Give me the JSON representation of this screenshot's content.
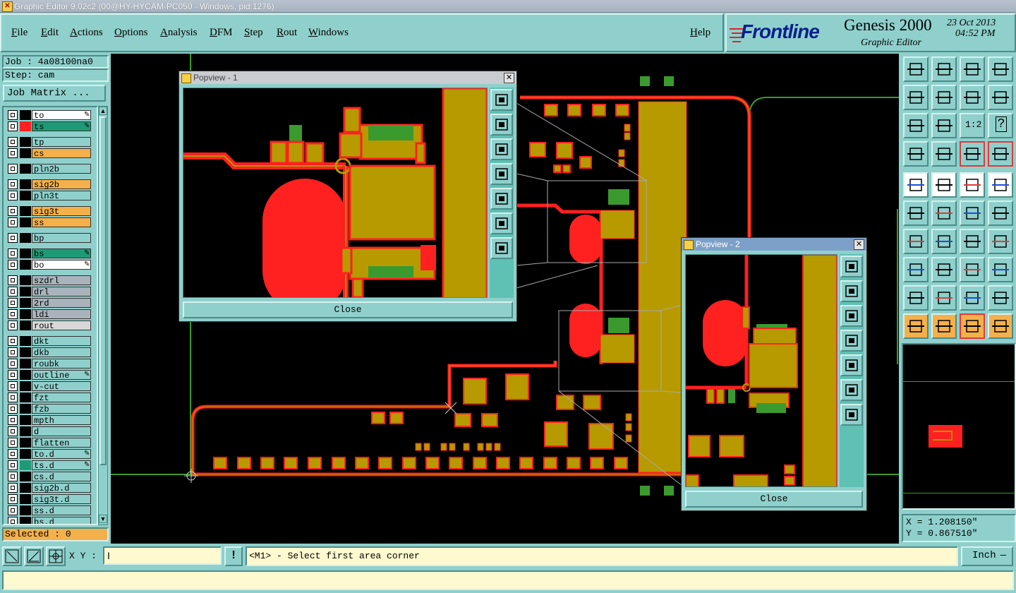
{
  "window": {
    "title": "Graphic Editor 9.02c2 (00@HY-HYCAM-PC050 - Windows, pid:1276)"
  },
  "menu": {
    "items": [
      "File",
      "Edit",
      "Actions",
      "Options",
      "Analysis",
      "DFM",
      "Step",
      "Rout",
      "Windows"
    ],
    "help": "Help"
  },
  "brand": {
    "logo": "Frontline",
    "product": "Genesis 2000",
    "subtitle": "Graphic Editor",
    "date": "23 Oct 2013",
    "time": "04:52 PM"
  },
  "job": {
    "job_label": "Job : 4a08100na0",
    "step_label": "Step: cam",
    "matrix_button": "Job Matrix ..."
  },
  "layers": [
    {
      "name": "to",
      "color": "#ffffff",
      "swatch": "#000000",
      "icon": true
    },
    {
      "name": "ts",
      "color": "#1f9a76",
      "swatch": "#ff2020",
      "icon": true
    },
    {
      "name": "tp",
      "color": "#8fd0cc",
      "swatch": "#000000"
    },
    {
      "name": "cs",
      "color": "#f4b04b",
      "swatch": "#000000"
    },
    {
      "name": "pln2b",
      "color": "#8fd0cc",
      "swatch": "#000000"
    },
    {
      "name": "sig2b",
      "color": "#f4b04b",
      "swatch": "#000000"
    },
    {
      "name": "pln3t",
      "color": "#8fd0cc",
      "swatch": "#000000"
    },
    {
      "name": "sig3t",
      "color": "#f4b04b",
      "swatch": "#000000"
    },
    {
      "name": "ss",
      "color": "#f4b04b",
      "swatch": "#000000"
    },
    {
      "name": "bp",
      "color": "#8fd0cc",
      "swatch": "#000000"
    },
    {
      "name": "bs",
      "color": "#1f9a76",
      "swatch": "#000000",
      "icon": true
    },
    {
      "name": "bo",
      "color": "#ffffff",
      "swatch": "#000000",
      "icon": true
    },
    {
      "name": "szdrl",
      "color": "#a9b3bc",
      "swatch": "#000000"
    },
    {
      "name": "drl",
      "color": "#a9b3bc",
      "swatch": "#000000"
    },
    {
      "name": "2rd",
      "color": "#a9b3bc",
      "swatch": "#000000"
    },
    {
      "name": "ldi",
      "color": "#a9b3bc",
      "swatch": "#000000"
    },
    {
      "name": "rout",
      "color": "#d8d8d8",
      "swatch": "#000000"
    },
    {
      "name": "dkt",
      "color": "#8fd0cc",
      "swatch": "#000000"
    },
    {
      "name": "dkb",
      "color": "#8fd0cc",
      "swatch": "#000000"
    },
    {
      "name": "roubk",
      "color": "#8fd0cc",
      "swatch": "#000000"
    },
    {
      "name": "outline",
      "color": "#8fd0cc",
      "swatch": "#000000",
      "icon": true
    },
    {
      "name": "v-cut",
      "color": "#8fd0cc",
      "swatch": "#000000"
    },
    {
      "name": "fzt",
      "color": "#8fd0cc",
      "swatch": "#000000"
    },
    {
      "name": "fzb",
      "color": "#8fd0cc",
      "swatch": "#000000"
    },
    {
      "name": "mpth",
      "color": "#8fd0cc",
      "swatch": "#000000"
    },
    {
      "name": "d",
      "color": "#8fd0cc",
      "swatch": "#000000"
    },
    {
      "name": "flatten",
      "color": "#8fd0cc",
      "swatch": "#000000"
    },
    {
      "name": "to.d",
      "color": "#8fd0cc",
      "swatch": "#000000",
      "icon": true
    },
    {
      "name": "ts.d",
      "color": "#8fd0cc",
      "swatch": "#1f9a76",
      "icon": true
    },
    {
      "name": "cs.d",
      "color": "#8fd0cc",
      "swatch": "#000000"
    },
    {
      "name": "sig2b.d",
      "color": "#8fd0cc",
      "swatch": "#000000"
    },
    {
      "name": "sig3t.d",
      "color": "#8fd0cc",
      "swatch": "#000000"
    },
    {
      "name": "ss.d",
      "color": "#8fd0cc",
      "swatch": "#000000"
    },
    {
      "name": "bs.d",
      "color": "#8fd0cc",
      "swatch": "#000000"
    }
  ],
  "selected": "Selected : 0",
  "popview1": {
    "title": "Popview - 1",
    "close": "Close"
  },
  "popview2": {
    "title": "Popview - 2",
    "close": "Close"
  },
  "coords": {
    "x": "X = 1.208150\"",
    "y": "Y = 0.867510\""
  },
  "statusbar": {
    "xy_label": "X Y :",
    "xy_value": "",
    "message": "<M1> - Select first area corner",
    "units": "Inch",
    "units_arrow": "—"
  },
  "toolbar_icons": [
    "zoom-home-icon",
    "zoom-in-icon",
    "home-icon",
    "layout-icon",
    "pan-left-icon",
    "pan-right-icon",
    "swap-icon",
    "snake-icon",
    "fit-icon",
    "center-icon",
    "ratio-icon",
    "help-icon",
    "tool-icon",
    "grid-icon",
    "layers-icon",
    "layers-red-icon",
    "add-pad-icon",
    "add-line-icon",
    "measure-icon",
    "circle-icon",
    "node-icon",
    "x-node-icon",
    "connect-icon",
    "connect2-icon",
    "angle-icon",
    "line-icon",
    "arc-icon",
    "split-icon",
    "select-pads-icon",
    "minus-line-icon",
    "array-icon",
    "group-icon",
    "triangle-icon",
    "triangle2-icon",
    "arch-icon",
    "arch2-icon",
    "pointer-icon",
    "pointer-box-icon",
    "pointer-red-icon",
    "route-icon"
  ],
  "ratio_label": "1:2",
  "help_label": "?"
}
